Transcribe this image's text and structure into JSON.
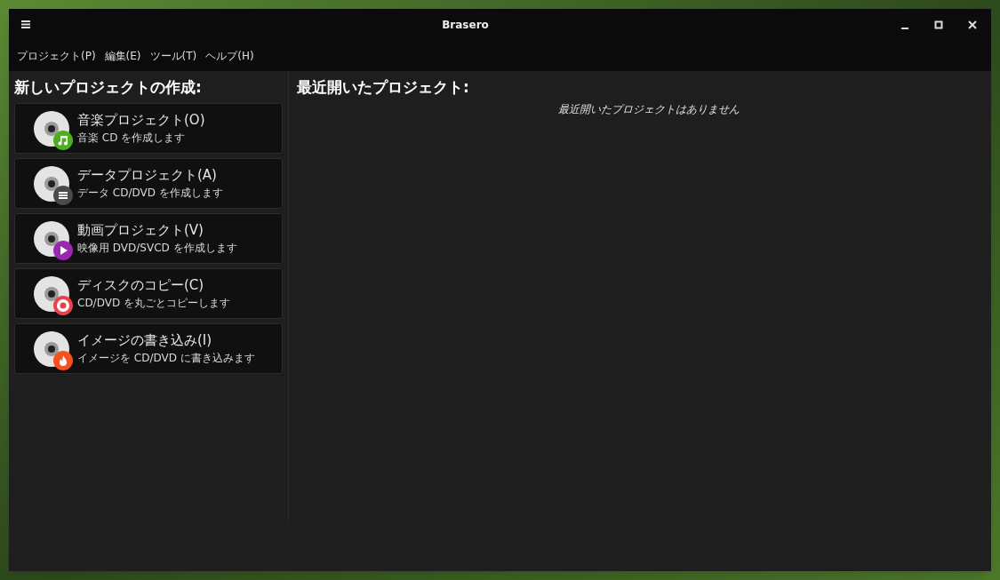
{
  "window": {
    "title": "Brasero"
  },
  "menu": [
    "プロジェクト(P)",
    "編集(E)",
    "ツール(T)",
    "ヘルプ(H)"
  ],
  "new_project": {
    "heading": "新しいプロジェクトの作成:",
    "items": [
      {
        "kind": "music",
        "title": "音楽プロジェクト(O)",
        "description": "音楽 CD を作成します"
      },
      {
        "kind": "data",
        "title": "データプロジェクト(A)",
        "description": "データ CD/DVD を作成します"
      },
      {
        "kind": "video",
        "title": "動画プロジェクト(V)",
        "description": "映像用 DVD/SVCD を作成します"
      },
      {
        "kind": "copy",
        "title": "ディスクのコピー(C)",
        "description": "CD/DVD を丸ごとコピーします"
      },
      {
        "kind": "burn",
        "title": "イメージの書き込み(I)",
        "description": "イメージを CD/DVD に書き込みます"
      }
    ]
  },
  "recent": {
    "heading": "最近開いたプロジェクト:",
    "empty_message": "最近開いたプロジェクトはありません"
  }
}
